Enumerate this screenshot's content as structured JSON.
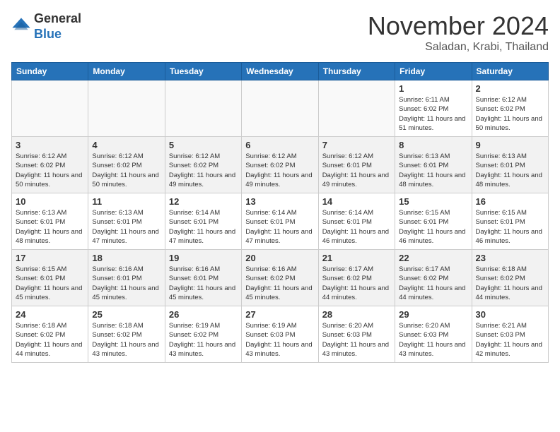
{
  "header": {
    "logo": {
      "general": "General",
      "blue": "Blue"
    },
    "month": "November 2024",
    "location": "Saladan, Krabi, Thailand"
  },
  "weekdays": [
    "Sunday",
    "Monday",
    "Tuesday",
    "Wednesday",
    "Thursday",
    "Friday",
    "Saturday"
  ],
  "weeks": [
    [
      {
        "day": "",
        "info": ""
      },
      {
        "day": "",
        "info": ""
      },
      {
        "day": "",
        "info": ""
      },
      {
        "day": "",
        "info": ""
      },
      {
        "day": "",
        "info": ""
      },
      {
        "day": "1",
        "info": "Sunrise: 6:11 AM\nSunset: 6:02 PM\nDaylight: 11 hours and 51 minutes."
      },
      {
        "day": "2",
        "info": "Sunrise: 6:12 AM\nSunset: 6:02 PM\nDaylight: 11 hours and 50 minutes."
      }
    ],
    [
      {
        "day": "3",
        "info": "Sunrise: 6:12 AM\nSunset: 6:02 PM\nDaylight: 11 hours and 50 minutes."
      },
      {
        "day": "4",
        "info": "Sunrise: 6:12 AM\nSunset: 6:02 PM\nDaylight: 11 hours and 50 minutes."
      },
      {
        "day": "5",
        "info": "Sunrise: 6:12 AM\nSunset: 6:02 PM\nDaylight: 11 hours and 49 minutes."
      },
      {
        "day": "6",
        "info": "Sunrise: 6:12 AM\nSunset: 6:02 PM\nDaylight: 11 hours and 49 minutes."
      },
      {
        "day": "7",
        "info": "Sunrise: 6:12 AM\nSunset: 6:01 PM\nDaylight: 11 hours and 49 minutes."
      },
      {
        "day": "8",
        "info": "Sunrise: 6:13 AM\nSunset: 6:01 PM\nDaylight: 11 hours and 48 minutes."
      },
      {
        "day": "9",
        "info": "Sunrise: 6:13 AM\nSunset: 6:01 PM\nDaylight: 11 hours and 48 minutes."
      }
    ],
    [
      {
        "day": "10",
        "info": "Sunrise: 6:13 AM\nSunset: 6:01 PM\nDaylight: 11 hours and 48 minutes."
      },
      {
        "day": "11",
        "info": "Sunrise: 6:13 AM\nSunset: 6:01 PM\nDaylight: 11 hours and 47 minutes."
      },
      {
        "day": "12",
        "info": "Sunrise: 6:14 AM\nSunset: 6:01 PM\nDaylight: 11 hours and 47 minutes."
      },
      {
        "day": "13",
        "info": "Sunrise: 6:14 AM\nSunset: 6:01 PM\nDaylight: 11 hours and 47 minutes."
      },
      {
        "day": "14",
        "info": "Sunrise: 6:14 AM\nSunset: 6:01 PM\nDaylight: 11 hours and 46 minutes."
      },
      {
        "day": "15",
        "info": "Sunrise: 6:15 AM\nSunset: 6:01 PM\nDaylight: 11 hours and 46 minutes."
      },
      {
        "day": "16",
        "info": "Sunrise: 6:15 AM\nSunset: 6:01 PM\nDaylight: 11 hours and 46 minutes."
      }
    ],
    [
      {
        "day": "17",
        "info": "Sunrise: 6:15 AM\nSunset: 6:01 PM\nDaylight: 11 hours and 45 minutes."
      },
      {
        "day": "18",
        "info": "Sunrise: 6:16 AM\nSunset: 6:01 PM\nDaylight: 11 hours and 45 minutes."
      },
      {
        "day": "19",
        "info": "Sunrise: 6:16 AM\nSunset: 6:01 PM\nDaylight: 11 hours and 45 minutes."
      },
      {
        "day": "20",
        "info": "Sunrise: 6:16 AM\nSunset: 6:02 PM\nDaylight: 11 hours and 45 minutes."
      },
      {
        "day": "21",
        "info": "Sunrise: 6:17 AM\nSunset: 6:02 PM\nDaylight: 11 hours and 44 minutes."
      },
      {
        "day": "22",
        "info": "Sunrise: 6:17 AM\nSunset: 6:02 PM\nDaylight: 11 hours and 44 minutes."
      },
      {
        "day": "23",
        "info": "Sunrise: 6:18 AM\nSunset: 6:02 PM\nDaylight: 11 hours and 44 minutes."
      }
    ],
    [
      {
        "day": "24",
        "info": "Sunrise: 6:18 AM\nSunset: 6:02 PM\nDaylight: 11 hours and 44 minutes."
      },
      {
        "day": "25",
        "info": "Sunrise: 6:18 AM\nSunset: 6:02 PM\nDaylight: 11 hours and 43 minutes."
      },
      {
        "day": "26",
        "info": "Sunrise: 6:19 AM\nSunset: 6:02 PM\nDaylight: 11 hours and 43 minutes."
      },
      {
        "day": "27",
        "info": "Sunrise: 6:19 AM\nSunset: 6:03 PM\nDaylight: 11 hours and 43 minutes."
      },
      {
        "day": "28",
        "info": "Sunrise: 6:20 AM\nSunset: 6:03 PM\nDaylight: 11 hours and 43 minutes."
      },
      {
        "day": "29",
        "info": "Sunrise: 6:20 AM\nSunset: 6:03 PM\nDaylight: 11 hours and 43 minutes."
      },
      {
        "day": "30",
        "info": "Sunrise: 6:21 AM\nSunset: 6:03 PM\nDaylight: 11 hours and 42 minutes."
      }
    ]
  ]
}
